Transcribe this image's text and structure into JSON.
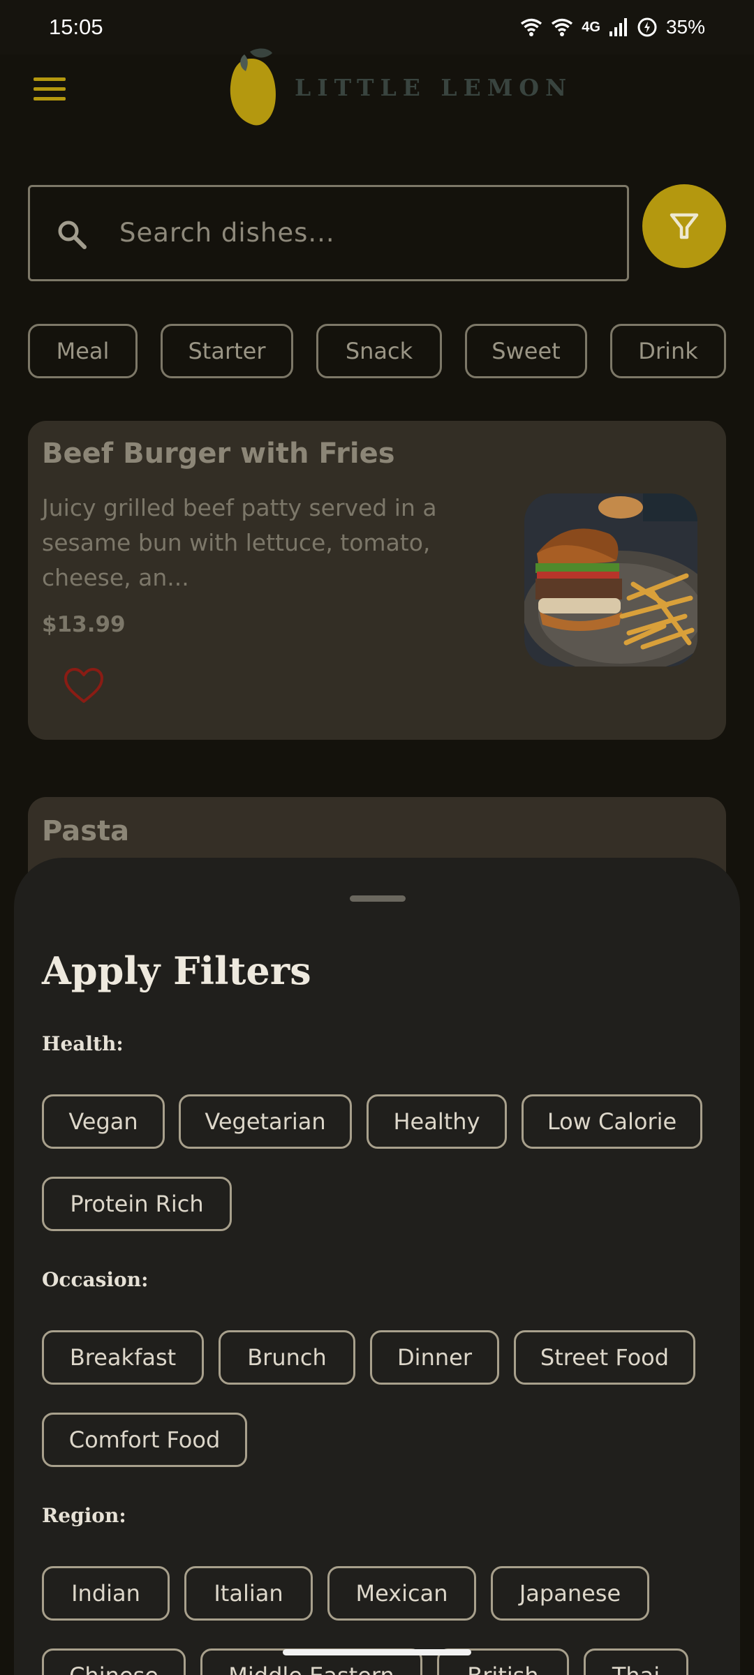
{
  "status_bar": {
    "time": "15:05",
    "network": "4G",
    "battery": "35%"
  },
  "app": {
    "brand": "LITTLE LEMON"
  },
  "search": {
    "placeholder": "Search dishes..."
  },
  "categories": [
    "Meal",
    "Starter",
    "Snack",
    "Sweet",
    "Drink"
  ],
  "dishes": [
    {
      "name": "Beef Burger with Fries",
      "description": "Juicy grilled beef patty served in a sesame bun with lettuce, tomato, cheese, an...",
      "price": "$13.99"
    },
    {
      "name": "Pasta"
    }
  ],
  "filter_sheet": {
    "title": "Apply Filters",
    "health_label": "Health:",
    "health": [
      "Vegan",
      "Vegetarian",
      "Healthy",
      "Low Calorie",
      "Protein Rich"
    ],
    "occasion_label": "Occasion:",
    "occasion": [
      "Breakfast",
      "Brunch",
      "Dinner",
      "Street Food",
      "Comfort Food"
    ],
    "region_label": "Region:",
    "region": [
      "Indian",
      "Italian",
      "Mexican",
      "Japanese",
      "Chinese",
      "Middle Eastern",
      "British",
      "Thai"
    ]
  },
  "colors": {
    "accent": "#b4980f",
    "card": "#332e25",
    "sheet": "#201f1c",
    "background": "#14120c"
  }
}
